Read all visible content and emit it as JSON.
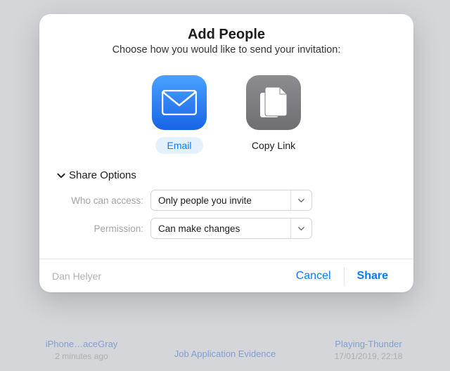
{
  "background": {
    "items": [
      {
        "title": "iPhone…aceGray",
        "meta": "2 minutes ago"
      },
      {
        "title": "Job Application Evidence",
        "meta": ""
      },
      {
        "title": "Playing-Thunder",
        "meta": "17/01/2019, 22:18"
      }
    ]
  },
  "modal": {
    "title": "Add People",
    "subtitle": "Choose how you would like to send your invitation:",
    "methods": {
      "email_label": "Email",
      "copylink_label": "Copy Link"
    },
    "share_options_heading": "Share Options",
    "rows": {
      "access_label": "Who can access:",
      "access_value": "Only people you invite",
      "permission_label": "Permission:",
      "permission_value": "Can make changes"
    },
    "footer": {
      "author": "Dan Helyer",
      "cancel": "Cancel",
      "share": "Share"
    }
  }
}
